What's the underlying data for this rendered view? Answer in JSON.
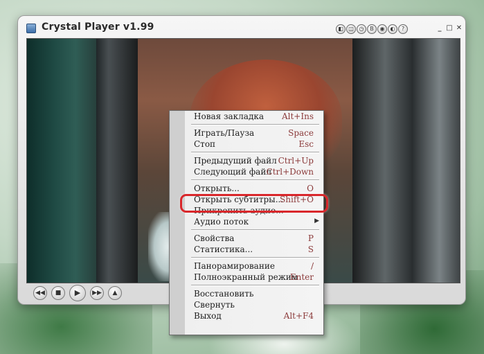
{
  "window": {
    "title": "Crystal Player v1.99",
    "title_buttons": [
      "◧",
      "◫",
      "◷",
      "B",
      "◉",
      "◐",
      "?"
    ],
    "win_buttons": [
      "_",
      "□",
      "✕"
    ]
  },
  "controls": {
    "prev": "◀◀",
    "stop": "■",
    "play": "▶",
    "next": "▶▶",
    "eject": "▲"
  },
  "menu": {
    "items": [
      {
        "label": "Новая закладка",
        "shortcut": "Alt+Ins"
      },
      {
        "separator": true
      },
      {
        "label": "Играть/Пауза",
        "shortcut": "Space"
      },
      {
        "label": "Стоп",
        "shortcut": "Esc"
      },
      {
        "separator": true
      },
      {
        "label": "Предыдущий файл",
        "shortcut": "Ctrl+Up"
      },
      {
        "label": "Следующий файл",
        "shortcut": "Ctrl+Down"
      },
      {
        "separator": true
      },
      {
        "label": "Открыть...",
        "shortcut": "O"
      },
      {
        "label": "Открыть субтитры...",
        "shortcut": "Shift+O"
      },
      {
        "label": "Прикрепить аудио...",
        "shortcut": ""
      },
      {
        "label": "Аудио поток",
        "shortcut": "",
        "submenu": true
      },
      {
        "separator": true
      },
      {
        "label": "Свойства",
        "shortcut": "P"
      },
      {
        "label": "Статистика...",
        "shortcut": "S"
      },
      {
        "separator": true
      },
      {
        "label": "Панорамирование",
        "shortcut": "/"
      },
      {
        "label": "Полноэкранный режим",
        "shortcut": "Enter"
      },
      {
        "separator": true
      },
      {
        "label": "Восстановить",
        "shortcut": ""
      },
      {
        "label": "Свернуть",
        "shortcut": ""
      },
      {
        "label": "Выход",
        "shortcut": "Alt+F4"
      }
    ]
  },
  "highlighted_item": "Открыть субтитры...",
  "colors": {
    "highlight": "#d9272b",
    "shortcut_text": "#8b3a3a"
  }
}
